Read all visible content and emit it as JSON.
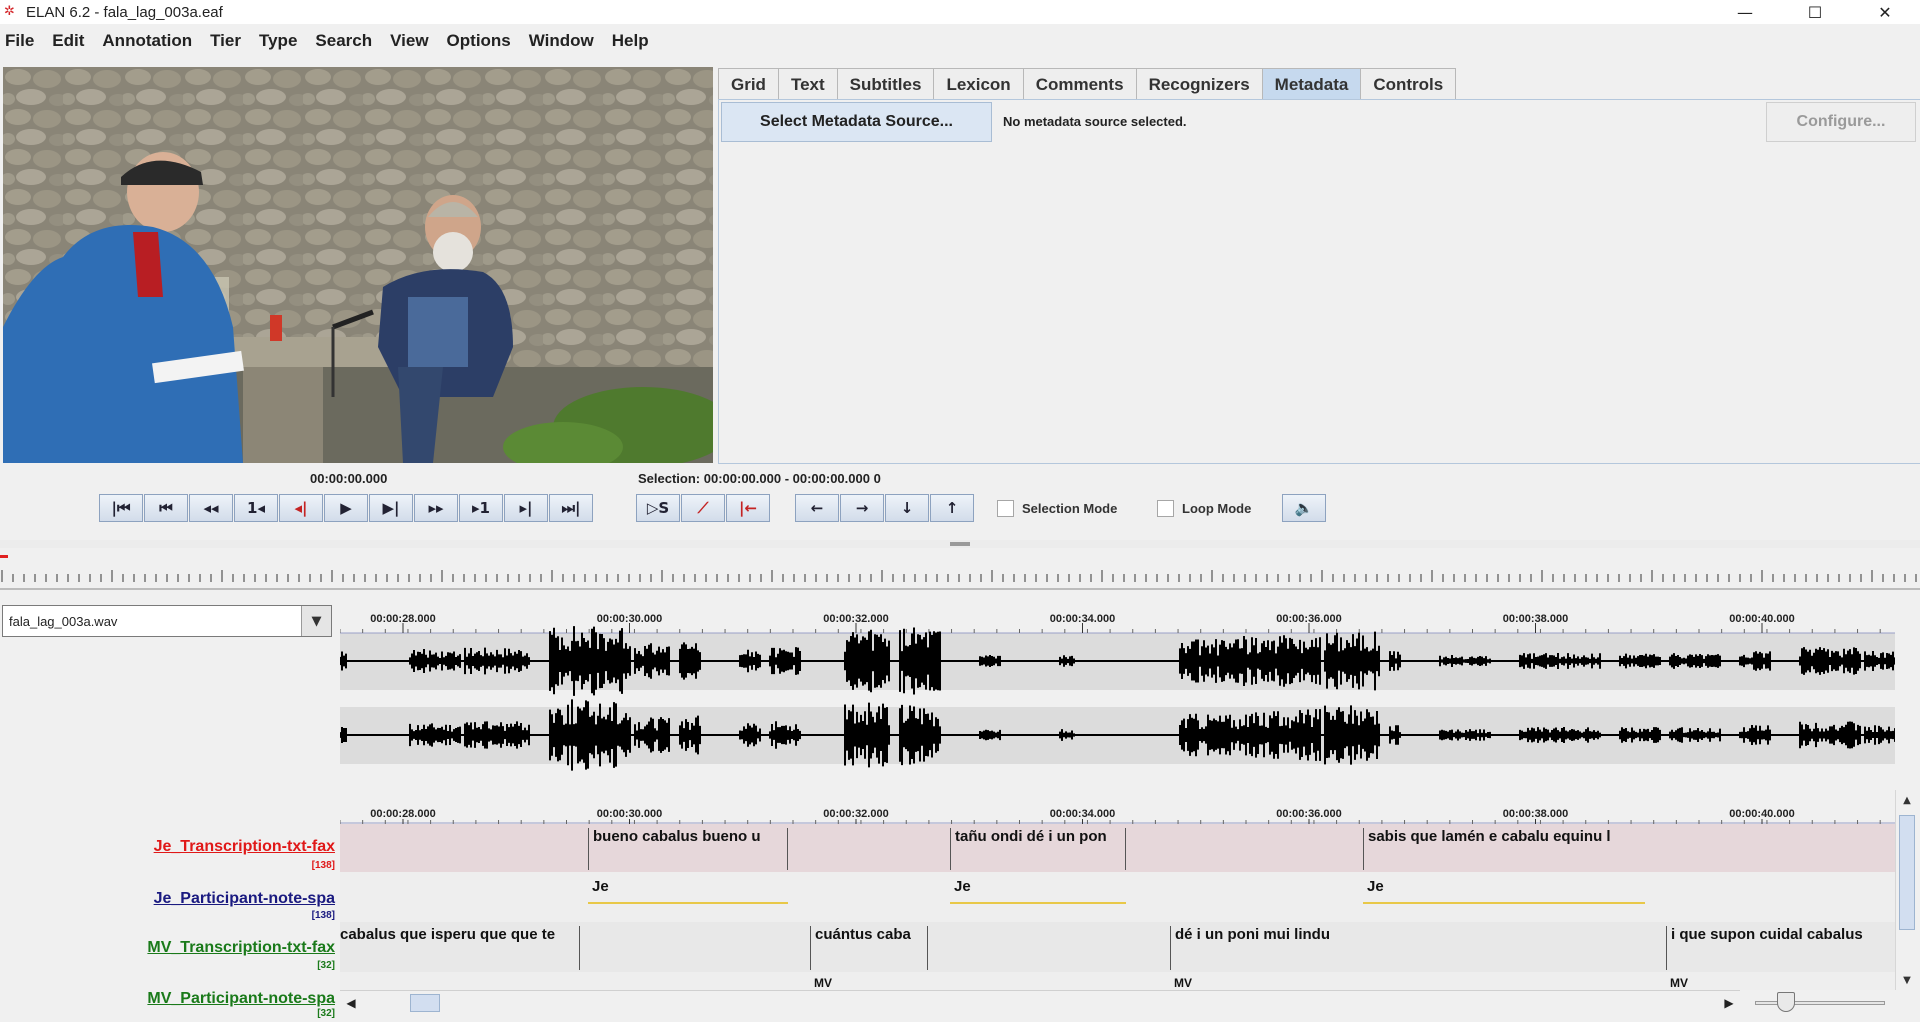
{
  "window": {
    "title": "ELAN 6.2 - fala_lag_003a.eaf",
    "controls": {
      "minimize": "—",
      "maximize": "☐",
      "close": "✕"
    }
  },
  "menu": [
    "File",
    "Edit",
    "Annotation",
    "Tier",
    "Type",
    "Search",
    "View",
    "Options",
    "Window",
    "Help"
  ],
  "tabs": [
    {
      "label": "Grid",
      "active": false
    },
    {
      "label": "Text",
      "active": false
    },
    {
      "label": "Subtitles",
      "active": false
    },
    {
      "label": "Lexicon",
      "active": false
    },
    {
      "label": "Comments",
      "active": false
    },
    {
      "label": "Recognizers",
      "active": false
    },
    {
      "label": "Metadata",
      "active": true
    },
    {
      "label": "Controls",
      "active": false
    }
  ],
  "metadata": {
    "select_button": "Select Metadata Source...",
    "status": "No metadata source selected.",
    "configure_button": "Configure..."
  },
  "player": {
    "current_time": "00:00:00.000",
    "selection": "Selection: 00:00:00.000 - 00:00:00.000  0",
    "selection_mode": "Selection Mode",
    "loop_mode": "Loop Mode",
    "buttons_group1": [
      "|⏮",
      "⏮",
      "◂◂",
      "1◂",
      "◂|",
      "▶",
      "▶|",
      "▸▸",
      "▸1",
      "▸|",
      "⏭|"
    ],
    "buttons_group2": [
      "▷S",
      "⟋",
      "|←"
    ],
    "buttons_group3": [
      "←",
      "→",
      "↓",
      "↑"
    ],
    "volume_icon": "🔈"
  },
  "media": {
    "file": "fala_lag_003a.wav"
  },
  "ruler": {
    "labels": [
      "00:00:28.000",
      "00:00:30.000",
      "00:00:32.000",
      "00:00:34.000",
      "00:00:36.000",
      "00:00:38.000",
      "00:00:40.000"
    ]
  },
  "tiers": [
    {
      "name": "Je_Transcription-txt-fax",
      "count": "[138]",
      "color": "#e01818"
    },
    {
      "name": "Je_Participant-note-spa",
      "count": "[138]",
      "color": "#1a1a80"
    },
    {
      "name": "MV_Transcription-txt-fax",
      "count": "[32]",
      "color": "#1a7a1a"
    },
    {
      "name": "MV_Participant-note-spa",
      "count": "[32]",
      "color": "#1a7a1a"
    }
  ],
  "annotations": {
    "je_transcription": [
      "bueno cabalus bueno u",
      "tañu ondi dé i un pon",
      "sabis que lamén e cabalu equinu l"
    ],
    "je_participant": [
      "Je",
      "Je",
      "Je"
    ],
    "mv_transcription": [
      "cabalus que isperu que que te",
      "cuántus caba",
      "dé i un poni mui lindu",
      "i que supon cuidal cabalus"
    ],
    "mv_participant": [
      "MV",
      "MV",
      "MV"
    ]
  },
  "colors": {
    "active_tab": "#c6d9ee",
    "selected_tier_bg": "#e6d7da",
    "tier_bg": "#eeeeee",
    "waveform": "#000000"
  }
}
